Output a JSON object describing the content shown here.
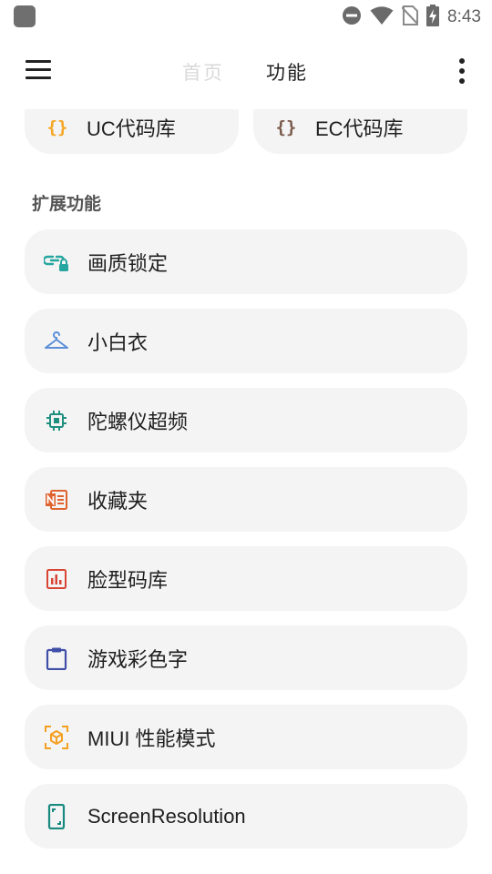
{
  "status_bar": {
    "time": "8:43"
  },
  "toolbar": {
    "tabs": [
      {
        "label": "首页",
        "active": false
      },
      {
        "label": "功能",
        "active": true
      }
    ]
  },
  "top_cards": [
    {
      "icon": "braces-icon",
      "icon_text": "{}",
      "label": "UC代码库",
      "color": "#f5a623"
    },
    {
      "icon": "braces-icon",
      "icon_text": "{}",
      "label": "EC代码库",
      "color": "#7a5a4a"
    }
  ],
  "section": {
    "title": "扩展功能"
  },
  "items": [
    {
      "icon": "link-lock-icon",
      "label": "画质锁定",
      "color": "#26a6a0"
    },
    {
      "icon": "hanger-icon",
      "label": "小白衣",
      "color": "#5b8fd8"
    },
    {
      "icon": "cpu-chip-icon",
      "label": "陀螺仪超频",
      "color": "#1f8f80"
    },
    {
      "icon": "notebook-icon",
      "label": "收藏夹",
      "color": "#e0622f"
    },
    {
      "icon": "bar-chart-icon",
      "label": "脸型码库",
      "color": "#d94535"
    },
    {
      "icon": "clipboard-icon",
      "label": "游戏彩色字",
      "color": "#3f4fa8"
    },
    {
      "icon": "ar-cube-icon",
      "label": "MIUI 性能模式",
      "color": "#f5a020"
    },
    {
      "icon": "phone-screen-icon",
      "label": "ScreenResolution",
      "color": "#188a80"
    }
  ]
}
